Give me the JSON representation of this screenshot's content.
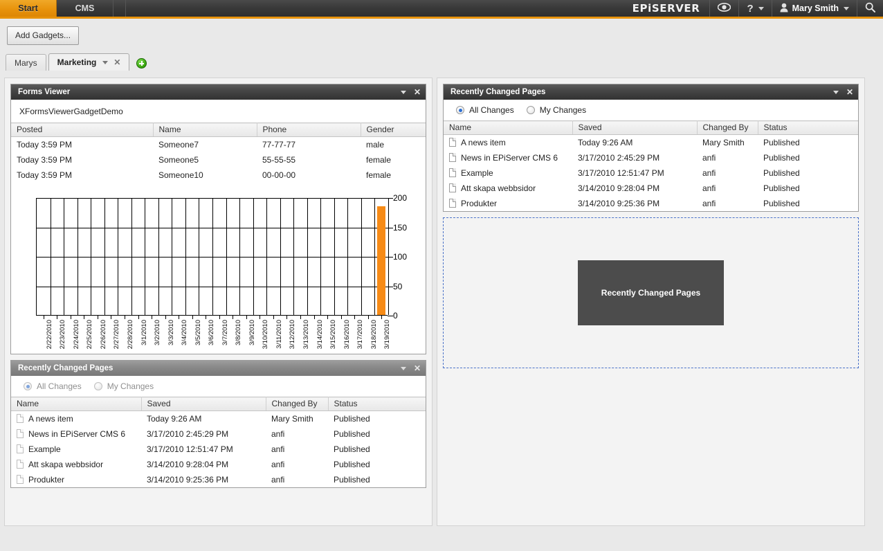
{
  "topbar": {
    "tabs": [
      {
        "label": "Start",
        "active": true
      },
      {
        "label": "CMS",
        "active": false
      }
    ],
    "brand": "EPiSERVER",
    "eye_icon": "eye-icon",
    "help_label": "?",
    "user_name": "Mary Smith",
    "search_icon": "search-icon",
    "accent_color": "#e8930c"
  },
  "toolbar": {
    "add_gadgets_label": "Add Gadgets..."
  },
  "dashboard_tabs": [
    {
      "label": "Marys",
      "active": false
    },
    {
      "label": "Marketing",
      "active": true
    }
  ],
  "add_tab_label": "+",
  "forms_viewer": {
    "title": "Forms Viewer",
    "form_name": "XFormsViewerGadgetDemo",
    "columns": [
      "Posted",
      "Name",
      "Phone",
      "Gender"
    ],
    "rows": [
      [
        "Today 3:59 PM",
        "Someone7",
        "77-77-77",
        "male"
      ],
      [
        "Today 3:59 PM",
        "Someone5",
        "55-55-55",
        "female"
      ],
      [
        "Today 3:59 PM",
        "Someone10",
        "00-00-00",
        "female"
      ]
    ]
  },
  "chart_data": {
    "type": "bar",
    "title": "",
    "xlabel": "",
    "ylabel": "",
    "ylim": [
      0,
      200
    ],
    "yticks": [
      0,
      50,
      100,
      150,
      200
    ],
    "grid": true,
    "legend": "none",
    "categories": [
      "2/22/2010",
      "2/23/2010",
      "2/24/2010",
      "2/25/2010",
      "2/26/2010",
      "2/27/2010",
      "2/28/2010",
      "3/1/2010",
      "3/2/2010",
      "3/3/2010",
      "3/4/2010",
      "3/5/2010",
      "3/6/2010",
      "3/7/2010",
      "3/8/2010",
      "3/9/2010",
      "3/10/2010",
      "3/11/2010",
      "3/12/2010",
      "3/13/2010",
      "3/14/2010",
      "3/15/2010",
      "3/16/2010",
      "3/17/2010",
      "3/18/2010",
      "3/19/2010"
    ],
    "values": [
      0,
      0,
      0,
      0,
      0,
      0,
      0,
      0,
      0,
      0,
      0,
      0,
      0,
      0,
      0,
      0,
      0,
      0,
      0,
      0,
      0,
      0,
      0,
      0,
      0,
      185
    ],
    "bar_color": "#f78b16"
  },
  "recently_changed_right": {
    "title": "Recently Changed Pages",
    "filters": [
      {
        "label": "All Changes",
        "selected": true
      },
      {
        "label": "My Changes",
        "selected": false
      }
    ],
    "columns": [
      "Name",
      "Saved",
      "Changed By",
      "Status"
    ],
    "rows": [
      [
        "A news item",
        "Today 9:26 AM",
        "Mary Smith",
        "Published"
      ],
      [
        "News in EPiServer CMS 6",
        "3/17/2010 2:45:29 PM",
        "anfi",
        "Published"
      ],
      [
        "Example",
        "3/17/2010 12:51:47 PM",
        "anfi",
        "Published"
      ],
      [
        "Att skapa webbsidor",
        "3/14/2010 9:28:04 PM",
        "anfi",
        "Published"
      ],
      [
        "Produkter",
        "3/14/2010 9:25:36 PM",
        "anfi",
        "Published"
      ]
    ]
  },
  "drop_placeholder": {
    "drag_proxy_label": "Recently Changed Pages",
    "border_color": "#4a72c8"
  },
  "recently_changed_left": {
    "title": "Recently Changed Pages",
    "filters": [
      {
        "label": "All Changes",
        "selected": true
      },
      {
        "label": "My Changes",
        "selected": false
      }
    ],
    "columns": [
      "Name",
      "Saved",
      "Changed By",
      "Status"
    ],
    "rows": [
      [
        "A news item",
        "Today 9:26 AM",
        "Mary Smith",
        "Published"
      ],
      [
        "News in EPiServer CMS 6",
        "3/17/2010 2:45:29 PM",
        "anfi",
        "Published"
      ],
      [
        "Example",
        "3/17/2010 12:51:47 PM",
        "anfi",
        "Published"
      ],
      [
        "Att skapa webbsidor",
        "3/14/2010 9:28:04 PM",
        "anfi",
        "Published"
      ],
      [
        "Produkter",
        "3/14/2010 9:25:36 PM",
        "anfi",
        "Published"
      ]
    ]
  }
}
